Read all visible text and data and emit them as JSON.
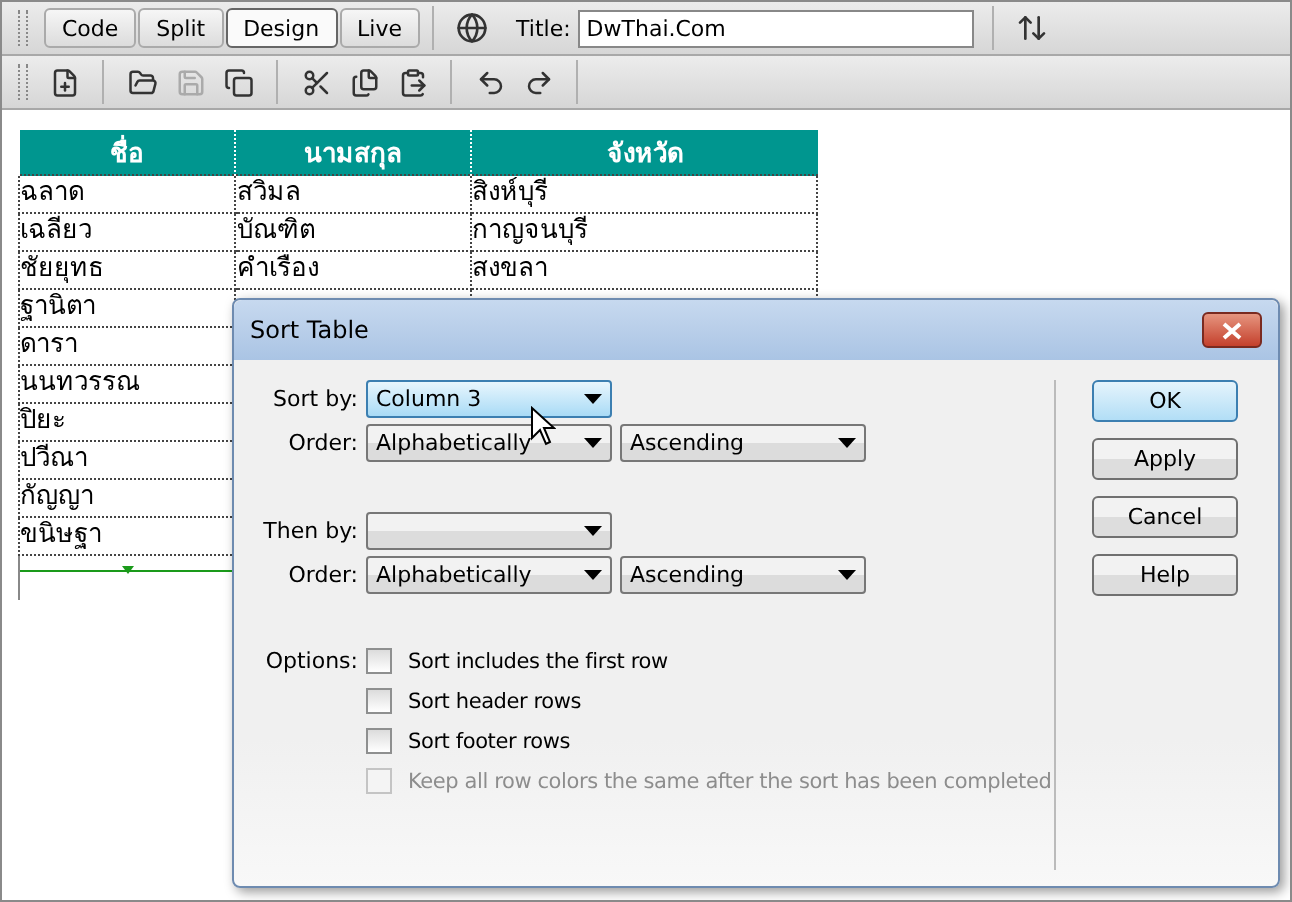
{
  "view_tabs": [
    {
      "label": "Code",
      "selected": false
    },
    {
      "label": "Split",
      "selected": false
    },
    {
      "label": "Design",
      "selected": true
    },
    {
      "label": "Live",
      "selected": false
    }
  ],
  "title_field": {
    "label": "Title:",
    "value": "DwThai.Com"
  },
  "table": {
    "columns": [
      "ชื่อ",
      "นามสกุล",
      "จังหวัด"
    ],
    "rows": [
      [
        "ฉลาด",
        "สวิมล",
        "สิงห์บุรี"
      ],
      [
        "เฉลียว",
        "บัณฑิต",
        "กาญจนบุรี"
      ],
      [
        "ชัยยุทธ",
        "คำเรือง",
        "สงขลา"
      ],
      [
        "ฐานิตา"
      ],
      [
        "ดารา"
      ],
      [
        "นนทวรรณ"
      ],
      [
        "ปิยะ"
      ],
      [
        "ปวีณา"
      ],
      [
        "กัญญา"
      ],
      [
        "ขนิษฐา"
      ]
    ]
  },
  "dialog": {
    "title": "Sort Table",
    "sort_by": {
      "label": "Sort by:",
      "value": "Column 3",
      "focused": true
    },
    "order_1": {
      "label": "Order:",
      "method": "Alphabetically",
      "direction": "Ascending"
    },
    "then_by": {
      "label": "Then by:"
    },
    "order_2": {
      "label": "Order:",
      "method": "Alphabetically",
      "direction": "Ascending"
    },
    "options_label": "Options:",
    "options": [
      {
        "label": "Sort includes the first row",
        "checked": false,
        "disabled": false
      },
      {
        "label": "Sort header rows",
        "checked": false,
        "disabled": false
      },
      {
        "label": "Sort footer rows",
        "checked": false,
        "disabled": false
      },
      {
        "label": "Keep all row colors the same after the sort has been completed",
        "checked": false,
        "disabled": true
      }
    ],
    "buttons": [
      {
        "label": "OK",
        "default": true
      },
      {
        "label": "Apply",
        "default": false
      },
      {
        "label": "Cancel",
        "default": false
      },
      {
        "label": "Help",
        "default": false
      }
    ]
  }
}
